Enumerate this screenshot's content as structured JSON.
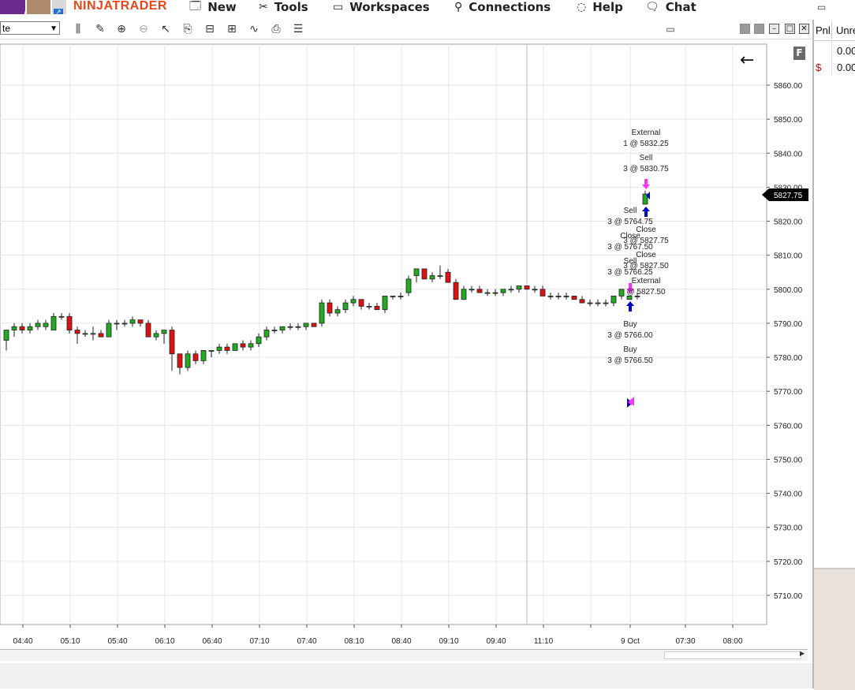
{
  "menu": {
    "brand": "NINJATRADER",
    "items": [
      {
        "label": "New",
        "icon": "new-window-icon"
      },
      {
        "label": "Tools",
        "icon": "tools-icon"
      },
      {
        "label": "Workspaces",
        "icon": "workspaces-icon"
      },
      {
        "label": "Connections",
        "icon": "plug-icon"
      },
      {
        "label": "Help",
        "icon": "help-icon"
      },
      {
        "label": "Chat",
        "icon": "chat-icon"
      }
    ]
  },
  "toolbar": {
    "instrument_value": "te",
    "flag_label": "F"
  },
  "right_panel": {
    "col1": "Pnl",
    "col2": "Unre",
    "rows": [
      {
        "prefix": "",
        "value": "0.00"
      },
      {
        "prefix": "$",
        "value": "0.00"
      }
    ]
  },
  "colors": {
    "up": "#22aa22",
    "down": "#dd1111",
    "brand": "#e8461a",
    "buy_arrow": "#0000cc",
    "sell_arrow": "#ff33ff"
  },
  "chart_data": {
    "type": "candlestick",
    "ylim": [
      5703,
      5871
    ],
    "y_ticks": [
      "5710.00",
      "5720.00",
      "5730.00",
      "5740.00",
      "5750.00",
      "5760.00",
      "5770.00",
      "5780.00",
      "5790.00",
      "5800.00",
      "5810.00",
      "5820.00",
      "5830.00",
      "5840.00",
      "5850.00",
      "5860.00"
    ],
    "x_ticks": [
      "04:40",
      "05:10",
      "05:40",
      "06:10",
      "06:40",
      "07:10",
      "07:40",
      "08:10",
      "08:40",
      "09:10",
      "09:40",
      "11:10",
      "9 Oct",
      "07:30",
      "08:00"
    ],
    "last_price": "5827.75",
    "candles": [
      [
        5785,
        5788,
        5782,
        5788
      ],
      [
        5788,
        5790,
        5786,
        5789
      ],
      [
        5789,
        5790,
        5787,
        5788
      ],
      [
        5788,
        5790,
        5787,
        5789
      ],
      [
        5789,
        5791,
        5788,
        5790
      ],
      [
        5789,
        5791,
        5788,
        5790
      ],
      [
        5788,
        5793,
        5788,
        5792
      ],
      [
        5792,
        5793,
        5791,
        5792
      ],
      [
        5792,
        5793,
        5787,
        5788
      ],
      [
        5788,
        5789,
        5784,
        5787
      ],
      [
        5787,
        5788,
        5786,
        5787
      ],
      [
        5787,
        5789,
        5785,
        5787
      ],
      [
        5787,
        5788,
        5786,
        5786
      ],
      [
        5786,
        5791,
        5786,
        5790
      ],
      [
        5790,
        5791,
        5788,
        5790
      ],
      [
        5790,
        5791,
        5789,
        5790
      ],
      [
        5790,
        5792,
        5789,
        5791
      ],
      [
        5791,
        5791,
        5789,
        5790
      ],
      [
        5790,
        5791,
        5786,
        5786
      ],
      [
        5786,
        5788,
        5785,
        5787
      ],
      [
        5787,
        5788,
        5784,
        5788
      ],
      [
        5788,
        5789,
        5776,
        5781
      ],
      [
        5781,
        5781,
        5775,
        5777
      ],
      [
        5777,
        5782,
        5776,
        5781
      ],
      [
        5781,
        5782,
        5778,
        5779
      ],
      [
        5779,
        5782,
        5778,
        5782
      ],
      [
        5782,
        5782,
        5780,
        5782
      ],
      [
        5782,
        5784,
        5781,
        5783
      ],
      [
        5783,
        5784,
        5781,
        5782
      ],
      [
        5782,
        5784,
        5782,
        5784
      ],
      [
        5784,
        5785,
        5782,
        5783
      ],
      [
        5783,
        5785,
        5782,
        5784
      ],
      [
        5784,
        5787,
        5783,
        5786
      ],
      [
        5786,
        5789,
        5785,
        5788
      ],
      [
        5788,
        5789,
        5787,
        5788
      ],
      [
        5788,
        5789,
        5787,
        5789
      ],
      [
        5789,
        5790,
        5788,
        5789
      ],
      [
        5789,
        5790,
        5788,
        5789
      ],
      [
        5789,
        5790,
        5788,
        5790
      ],
      [
        5790,
        5790,
        5789,
        5789
      ],
      [
        5790,
        5797,
        5789,
        5796
      ],
      [
        5796,
        5797,
        5792,
        5793
      ],
      [
        5793,
        5795,
        5792,
        5794
      ],
      [
        5794,
        5797,
        5793,
        5796
      ],
      [
        5796,
        5798,
        5795,
        5797
      ],
      [
        5797,
        5797,
        5794,
        5795
      ],
      [
        5795,
        5796,
        5794,
        5795
      ],
      [
        5795,
        5796,
        5794,
        5794
      ],
      [
        5794,
        5798,
        5793,
        5798
      ],
      [
        5798,
        5798,
        5797,
        5798
      ],
      [
        5798,
        5799,
        5797,
        5798
      ],
      [
        5799,
        5804,
        5798,
        5803
      ],
      [
        5804,
        5806,
        5802,
        5806
      ],
      [
        5806,
        5806,
        5803,
        5803
      ],
      [
        5803,
        5805,
        5802,
        5804
      ],
      [
        5804,
        5807,
        5803,
        5804
      ],
      [
        5805,
        5806,
        5802,
        5802
      ],
      [
        5802,
        5803,
        5797,
        5797
      ],
      [
        5797,
        5801,
        5797,
        5800
      ],
      [
        5800,
        5801,
        5799,
        5800
      ],
      [
        5800,
        5801,
        5799,
        5799
      ],
      [
        5799,
        5800,
        5798,
        5799
      ],
      [
        5799,
        5800,
        5798,
        5799
      ],
      [
        5799,
        5800,
        5798,
        5800
      ],
      [
        5800,
        5801,
        5799,
        5800
      ],
      [
        5800,
        5801,
        5799,
        5801
      ],
      [
        5801,
        5801,
        5800,
        5800
      ],
      [
        5800,
        5801,
        5799,
        5800
      ],
      [
        5800,
        5801,
        5798,
        5798
      ],
      [
        5798,
        5799,
        5797,
        5798
      ],
      [
        5798,
        5799,
        5797,
        5798
      ],
      [
        5798,
        5799,
        5797,
        5798
      ],
      [
        5798,
        5798,
        5797,
        5797
      ],
      [
        5797,
        5798,
        5796,
        5796
      ],
      [
        5796,
        5797,
        5795,
        5796
      ],
      [
        5796,
        5797,
        5795,
        5796
      ],
      [
        5796,
        5797,
        5795,
        5796
      ],
      [
        5796,
        5798,
        5795,
        5798
      ],
      [
        5798,
        5800,
        5797,
        5800
      ],
      [
        5797,
        5798,
        5797,
        5798
      ],
      [
        5798,
        5799,
        5797,
        5798
      ]
    ],
    "last_candle": [
      5825,
      5829,
      5825,
      5828
    ],
    "annotations": [
      {
        "lines": [
          "External",
          "1 @ 5832.25"
        ],
        "x": 819,
        "y": 167
      },
      {
        "lines": [
          "Sell",
          "3 @ 5830.75"
        ],
        "x": 819,
        "y": 199
      },
      {
        "lines": [
          "Sell",
          "3 @ 5764.75"
        ],
        "x": 799,
        "y": 266
      },
      {
        "lines": [
          "Close",
          "3 @ 5827.75"
        ],
        "x": 819,
        "y": 290
      },
      {
        "lines": [
          "Close",
          "3 @ 5767.50"
        ],
        "x": 799,
        "y": 298
      },
      {
        "lines": [
          "Close",
          "3 @ 5827.50"
        ],
        "x": 819,
        "y": 322
      },
      {
        "lines": [
          "Sell",
          "3 @ 5766.25"
        ],
        "x": 799,
        "y": 330
      },
      {
        "lines": [
          "External",
          "@ 5827.50"
        ],
        "x": 819,
        "y": 355
      },
      {
        "lines": [
          "Buy",
          "3 @ 5766.00"
        ],
        "x": 799,
        "y": 410
      },
      {
        "lines": [
          "Buy",
          "3 @ 5766.50"
        ],
        "x": 799,
        "y": 442
      }
    ]
  }
}
